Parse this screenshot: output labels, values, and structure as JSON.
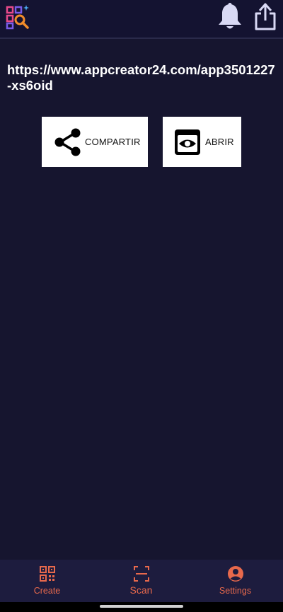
{
  "header": {
    "logo_icon": "qr-search-app-logo",
    "bell_icon": "notification-bell",
    "share_icon": "share-export"
  },
  "result": {
    "url": "https://www.appcreator24.com/app3501227-xs6oid"
  },
  "actions": {
    "share_label": "COMPARTIR",
    "open_label": "ABRIR"
  },
  "nav": {
    "create_label": "Create",
    "scan_label": "Scan",
    "settings_label": "Settings"
  },
  "colors": {
    "background": "#16152f",
    "nav_background": "#1d1c3e",
    "accent": "#e8694c",
    "icon_light": "#d9d9f5"
  }
}
